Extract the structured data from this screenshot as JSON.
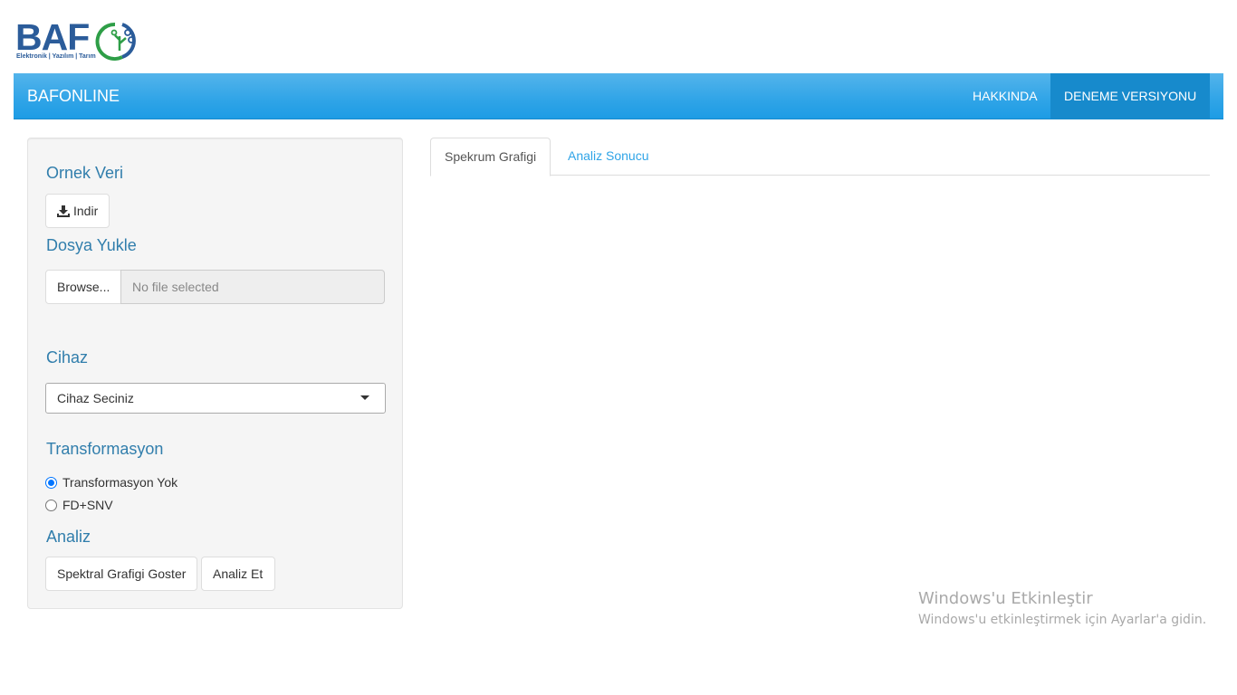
{
  "logo": {
    "text": "BAF",
    "tagline": "Elektronik | Yazılım | Tarım",
    "colors": {
      "blue": "#2b5c9a",
      "green": "#2e9e47"
    }
  },
  "navbar": {
    "brand": "BAFONLINE",
    "items": [
      {
        "label": "HAKKINDA",
        "active": false
      },
      {
        "label": "DENEME VERSIYONU",
        "active": true
      }
    ],
    "colors": {
      "bar": "#2fa4e7",
      "active": "#178acc"
    }
  },
  "sidebar": {
    "sample": {
      "title": "Ornek Veri",
      "download_label": "Indir",
      "icon": "download-icon"
    },
    "upload": {
      "title": "Dosya Yukle",
      "browse_label": "Browse...",
      "file_placeholder": "No file selected"
    },
    "device": {
      "title": "Cihaz",
      "selected": "Cihaz Seciniz"
    },
    "transformation": {
      "title": "Transformasyon",
      "options": [
        {
          "label": "Transformasyon Yok",
          "checked": true
        },
        {
          "label": "FD+SNV",
          "checked": false
        }
      ]
    },
    "analysis": {
      "title": "Analiz",
      "show_spectrum_label": "Spektral Grafigi Goster",
      "analyze_label": "Analiz Et"
    }
  },
  "main": {
    "tabs": [
      {
        "label": "Spekrum Grafigi",
        "active": true
      },
      {
        "label": "Analiz Sonucu",
        "active": false
      }
    ]
  },
  "watermark": {
    "title": "Windows'u Etkinleştir",
    "subtitle": "Windows'u etkinleştirmek için Ayarlar'a gidin."
  }
}
